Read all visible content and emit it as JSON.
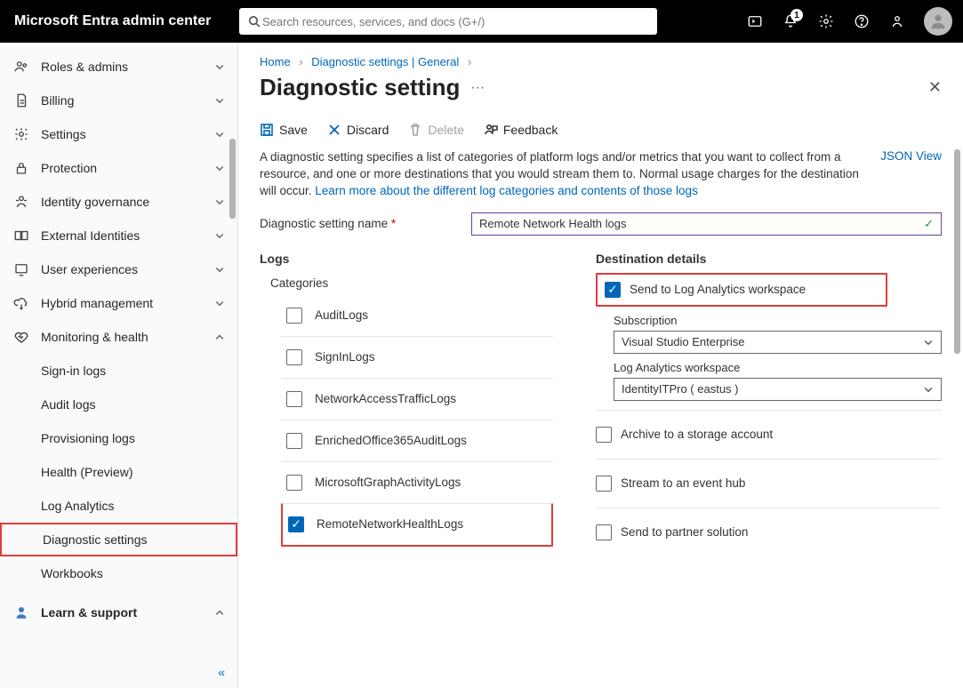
{
  "header": {
    "brand": "Microsoft Entra admin center",
    "search_placeholder": "Search resources, services, and docs (G+/)",
    "notif_count": "1"
  },
  "sidebar": {
    "items": [
      {
        "label": "Roles & admins",
        "chev": "down"
      },
      {
        "label": "Billing",
        "chev": "down"
      },
      {
        "label": "Settings",
        "chev": "down"
      },
      {
        "label": "Protection",
        "chev": "down"
      },
      {
        "label": "Identity governance",
        "chev": "down"
      },
      {
        "label": "External Identities",
        "chev": "down"
      },
      {
        "label": "User experiences",
        "chev": "down"
      },
      {
        "label": "Hybrid management",
        "chev": "down"
      },
      {
        "label": "Monitoring & health",
        "chev": "up"
      }
    ],
    "sub": [
      "Sign-in logs",
      "Audit logs",
      "Provisioning logs",
      "Health (Preview)",
      "Log Analytics",
      "Diagnostic settings",
      "Workbooks"
    ],
    "learn": "Learn & support"
  },
  "crumbs": {
    "a": "Home",
    "b": "Diagnostic settings | General"
  },
  "title": "Diagnostic setting",
  "toolbar": {
    "save": "Save",
    "discard": "Discard",
    "delete": "Delete",
    "feedback": "Feedback"
  },
  "desc": {
    "text_a": "A diagnostic setting specifies a list of categories of platform logs and/or metrics that you want to collect from a resource, and one or more destinations that you would stream them to. Normal usage charges for the destination will occur. ",
    "link": "Learn more about the different log categories and contents of those logs",
    "json_view": "JSON View"
  },
  "name_field": {
    "label": "Diagnostic setting name",
    "value": "Remote Network Health logs"
  },
  "logs": {
    "title": "Logs",
    "categories_label": "Categories",
    "items": [
      {
        "label": "AuditLogs",
        "checked": false
      },
      {
        "label": "SignInLogs",
        "checked": false
      },
      {
        "label": "NetworkAccessTrafficLogs",
        "checked": false
      },
      {
        "label": "EnrichedOffice365AuditLogs",
        "checked": false
      },
      {
        "label": "MicrosoftGraphActivityLogs",
        "checked": false
      },
      {
        "label": "RemoteNetworkHealthLogs",
        "checked": true
      }
    ]
  },
  "dest": {
    "title": "Destination details",
    "items": [
      {
        "label": "Send to Log Analytics workspace",
        "checked": true,
        "sub": {
          "label": "Subscription",
          "value": "Visual Studio Enterprise"
        },
        "ws": {
          "label": "Log Analytics workspace",
          "value": "IdentityITPro ( eastus )"
        }
      },
      {
        "label": "Archive to a storage account",
        "checked": false
      },
      {
        "label": "Stream to an event hub",
        "checked": false
      },
      {
        "label": "Send to partner solution",
        "checked": false
      }
    ]
  }
}
